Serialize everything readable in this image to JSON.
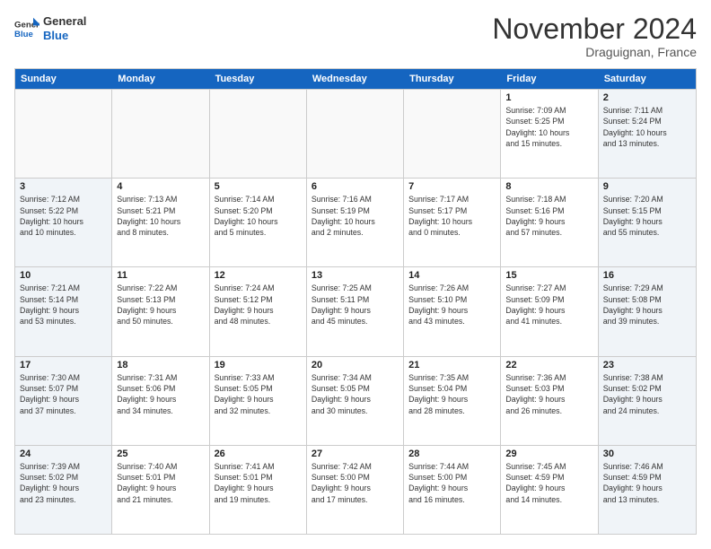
{
  "header": {
    "logo_line1": "General",
    "logo_line2": "Blue",
    "month_title": "November 2024",
    "location": "Draguignan, France"
  },
  "days_of_week": [
    "Sunday",
    "Monday",
    "Tuesday",
    "Wednesday",
    "Thursday",
    "Friday",
    "Saturday"
  ],
  "rows": [
    {
      "cells": [
        {
          "day": "",
          "info": "",
          "empty": true
        },
        {
          "day": "",
          "info": "",
          "empty": true
        },
        {
          "day": "",
          "info": "",
          "empty": true
        },
        {
          "day": "",
          "info": "",
          "empty": true
        },
        {
          "day": "",
          "info": "",
          "empty": true
        },
        {
          "day": "1",
          "info": "Sunrise: 7:09 AM\nSunset: 5:25 PM\nDaylight: 10 hours\nand 15 minutes.",
          "weekend": false
        },
        {
          "day": "2",
          "info": "Sunrise: 7:11 AM\nSunset: 5:24 PM\nDaylight: 10 hours\nand 13 minutes.",
          "weekend": true
        }
      ]
    },
    {
      "cells": [
        {
          "day": "3",
          "info": "Sunrise: 7:12 AM\nSunset: 5:22 PM\nDaylight: 10 hours\nand 10 minutes.",
          "weekend": true
        },
        {
          "day": "4",
          "info": "Sunrise: 7:13 AM\nSunset: 5:21 PM\nDaylight: 10 hours\nand 8 minutes.",
          "weekend": false
        },
        {
          "day": "5",
          "info": "Sunrise: 7:14 AM\nSunset: 5:20 PM\nDaylight: 10 hours\nand 5 minutes.",
          "weekend": false
        },
        {
          "day": "6",
          "info": "Sunrise: 7:16 AM\nSunset: 5:19 PM\nDaylight: 10 hours\nand 2 minutes.",
          "weekend": false
        },
        {
          "day": "7",
          "info": "Sunrise: 7:17 AM\nSunset: 5:17 PM\nDaylight: 10 hours\nand 0 minutes.",
          "weekend": false
        },
        {
          "day": "8",
          "info": "Sunrise: 7:18 AM\nSunset: 5:16 PM\nDaylight: 9 hours\nand 57 minutes.",
          "weekend": false
        },
        {
          "day": "9",
          "info": "Sunrise: 7:20 AM\nSunset: 5:15 PM\nDaylight: 9 hours\nand 55 minutes.",
          "weekend": true
        }
      ]
    },
    {
      "cells": [
        {
          "day": "10",
          "info": "Sunrise: 7:21 AM\nSunset: 5:14 PM\nDaylight: 9 hours\nand 53 minutes.",
          "weekend": true
        },
        {
          "day": "11",
          "info": "Sunrise: 7:22 AM\nSunset: 5:13 PM\nDaylight: 9 hours\nand 50 minutes.",
          "weekend": false
        },
        {
          "day": "12",
          "info": "Sunrise: 7:24 AM\nSunset: 5:12 PM\nDaylight: 9 hours\nand 48 minutes.",
          "weekend": false
        },
        {
          "day": "13",
          "info": "Sunrise: 7:25 AM\nSunset: 5:11 PM\nDaylight: 9 hours\nand 45 minutes.",
          "weekend": false
        },
        {
          "day": "14",
          "info": "Sunrise: 7:26 AM\nSunset: 5:10 PM\nDaylight: 9 hours\nand 43 minutes.",
          "weekend": false
        },
        {
          "day": "15",
          "info": "Sunrise: 7:27 AM\nSunset: 5:09 PM\nDaylight: 9 hours\nand 41 minutes.",
          "weekend": false
        },
        {
          "day": "16",
          "info": "Sunrise: 7:29 AM\nSunset: 5:08 PM\nDaylight: 9 hours\nand 39 minutes.",
          "weekend": true
        }
      ]
    },
    {
      "cells": [
        {
          "day": "17",
          "info": "Sunrise: 7:30 AM\nSunset: 5:07 PM\nDaylight: 9 hours\nand 37 minutes.",
          "weekend": true
        },
        {
          "day": "18",
          "info": "Sunrise: 7:31 AM\nSunset: 5:06 PM\nDaylight: 9 hours\nand 34 minutes.",
          "weekend": false
        },
        {
          "day": "19",
          "info": "Sunrise: 7:33 AM\nSunset: 5:05 PM\nDaylight: 9 hours\nand 32 minutes.",
          "weekend": false
        },
        {
          "day": "20",
          "info": "Sunrise: 7:34 AM\nSunset: 5:05 PM\nDaylight: 9 hours\nand 30 minutes.",
          "weekend": false
        },
        {
          "day": "21",
          "info": "Sunrise: 7:35 AM\nSunset: 5:04 PM\nDaylight: 9 hours\nand 28 minutes.",
          "weekend": false
        },
        {
          "day": "22",
          "info": "Sunrise: 7:36 AM\nSunset: 5:03 PM\nDaylight: 9 hours\nand 26 minutes.",
          "weekend": false
        },
        {
          "day": "23",
          "info": "Sunrise: 7:38 AM\nSunset: 5:02 PM\nDaylight: 9 hours\nand 24 minutes.",
          "weekend": true
        }
      ]
    },
    {
      "cells": [
        {
          "day": "24",
          "info": "Sunrise: 7:39 AM\nSunset: 5:02 PM\nDaylight: 9 hours\nand 23 minutes.",
          "weekend": true
        },
        {
          "day": "25",
          "info": "Sunrise: 7:40 AM\nSunset: 5:01 PM\nDaylight: 9 hours\nand 21 minutes.",
          "weekend": false
        },
        {
          "day": "26",
          "info": "Sunrise: 7:41 AM\nSunset: 5:01 PM\nDaylight: 9 hours\nand 19 minutes.",
          "weekend": false
        },
        {
          "day": "27",
          "info": "Sunrise: 7:42 AM\nSunset: 5:00 PM\nDaylight: 9 hours\nand 17 minutes.",
          "weekend": false
        },
        {
          "day": "28",
          "info": "Sunrise: 7:44 AM\nSunset: 5:00 PM\nDaylight: 9 hours\nand 16 minutes.",
          "weekend": false
        },
        {
          "day": "29",
          "info": "Sunrise: 7:45 AM\nSunset: 4:59 PM\nDaylight: 9 hours\nand 14 minutes.",
          "weekend": false
        },
        {
          "day": "30",
          "info": "Sunrise: 7:46 AM\nSunset: 4:59 PM\nDaylight: 9 hours\nand 13 minutes.",
          "weekend": true
        }
      ]
    }
  ]
}
